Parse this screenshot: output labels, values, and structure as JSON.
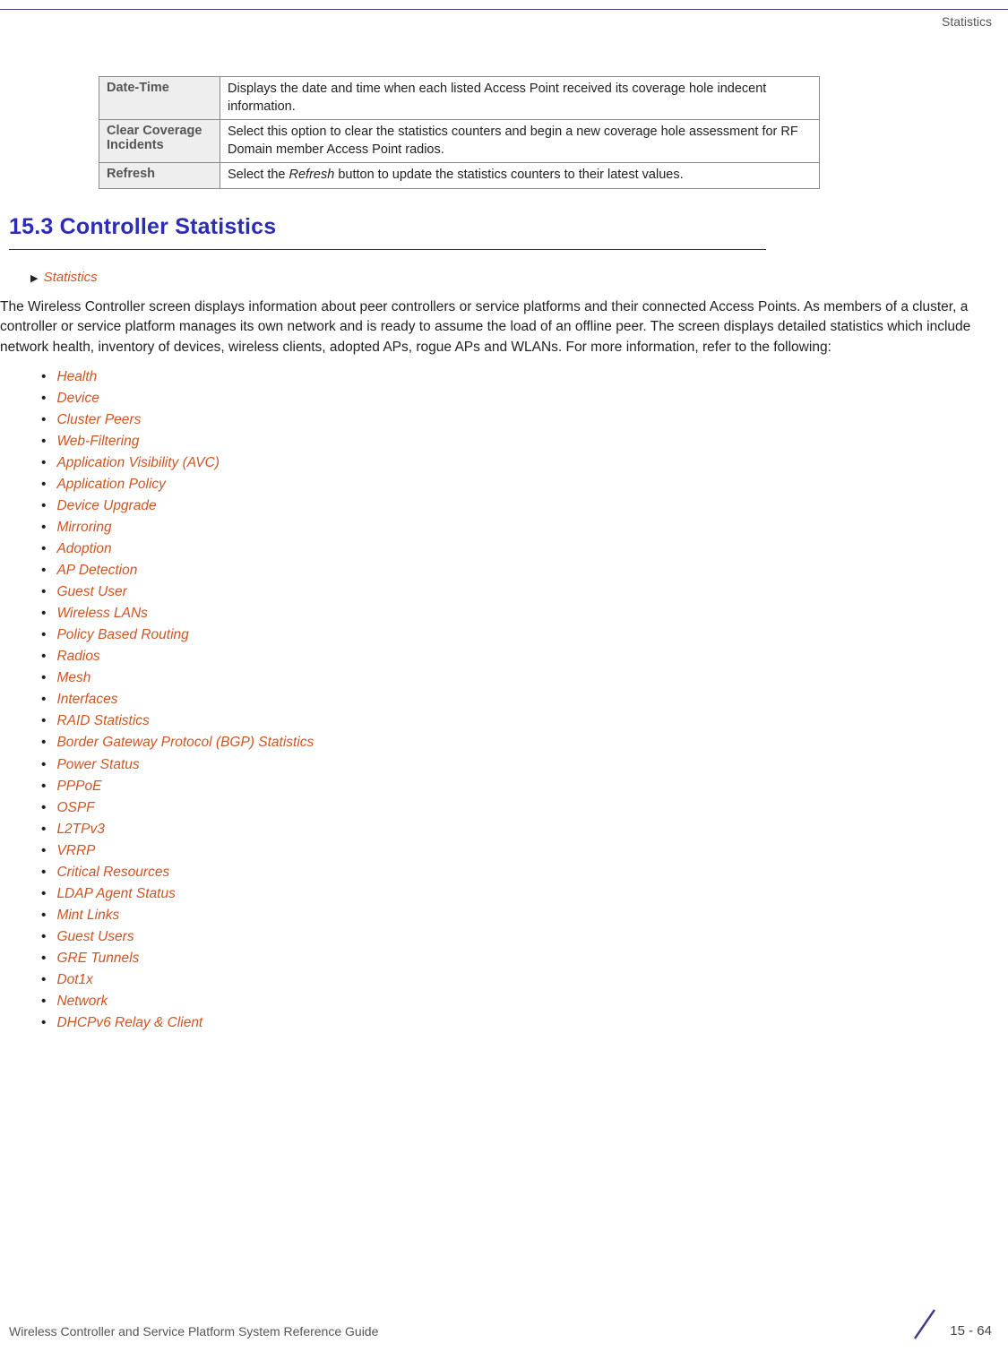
{
  "header": {
    "section_label": "Statistics"
  },
  "table": {
    "rows": [
      {
        "label": "Date-Time",
        "desc": "Displays the date and time when each listed Access Point received its coverage hole indecent information."
      },
      {
        "label": "Clear Coverage Incidents",
        "desc": "Select this option to clear the statistics counters and begin a new coverage hole assessment for RF Domain member Access Point radios."
      },
      {
        "label": "Refresh",
        "desc_prefix": "Select the ",
        "desc_em": "Refresh",
        "desc_suffix": " button to update the statistics counters to their latest values."
      }
    ]
  },
  "section": {
    "heading": "15.3 Controller Statistics",
    "breadcrumb": "Statistics",
    "paragraph": "The Wireless Controller screen displays information about peer controllers or service platforms and their connected Access Points. As members of a cluster, a controller or service platform manages its own network and is ready to assume the load of an offline peer. The screen displays detailed statistics which include network health, inventory of devices, wireless clients, adopted APs, rogue APs and WLANs. For more information, refer to the following:"
  },
  "topics": [
    "Health",
    "Device",
    "Cluster Peers",
    "Web-Filtering",
    "Application Visibility (AVC)",
    "Application Policy",
    "Device Upgrade",
    "Mirroring",
    "Adoption",
    "AP Detection",
    "Guest User",
    "Wireless LANs",
    "Policy Based Routing",
    "Radios",
    "Mesh",
    "Interfaces",
    "RAID Statistics",
    "Border Gateway Protocol (BGP) Statistics",
    "Power Status",
    "PPPoE",
    "OSPF",
    "L2TPv3",
    "VRRP",
    "Critical Resources",
    "LDAP Agent Status",
    "Mint Links",
    "Guest Users",
    "GRE Tunnels",
    "Dot1x",
    "Network",
    "DHCPv6 Relay & Client"
  ],
  "footer": {
    "title": "Wireless Controller and Service Platform System Reference Guide",
    "page": "15 - 64"
  }
}
